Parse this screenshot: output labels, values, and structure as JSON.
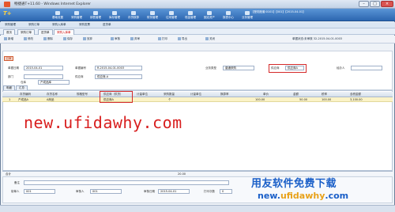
{
  "window": {
    "title": "畅捷通T+11.60 - Windows Internet Explorer"
  },
  "menubar": {
    "logo": "T+",
    "items": [
      "基础设置",
      "采购管理",
      "销售管理",
      "库存管理",
      "存货核算",
      "财务管理",
      "往来管理",
      "现金管理",
      "固定资产",
      "报表中心",
      "业务管理",
      "生产管理",
      "系统管理"
    ],
    "userinfo": "【登陆账套:0101】【001】【2015-04-01】"
  },
  "nav": {
    "tabs": [
      "采购管理",
      "采购订单",
      "采购入库单",
      "采购发票",
      "进货单"
    ],
    "doc_tabs": [
      "首页",
      "采购订单",
      "进货单",
      "采购入库单"
    ]
  },
  "toolbar": {
    "items": [
      "新增",
      "修改",
      "删除",
      "保存",
      "放弃",
      "审核",
      "弃审",
      "打印",
      "导出",
      "关闭"
    ],
    "right_label": "单据状态:未审核 32-2015-04-01-0003"
  },
  "form": {
    "badge": "已审",
    "fields": [
      {
        "label": "单据日期",
        "value": "2015-04-01"
      },
      {
        "label": "单据编号",
        "value": "R-2015-04-01-0003"
      },
      {
        "label": "业务类型",
        "value": "普通采购"
      },
      {
        "label": "供应商",
        "value": "供应商-A"
      },
      {
        "label": "部门",
        "value": ""
      },
      {
        "label": "仓库",
        "value": "产成品库"
      },
      {
        "label": "经办人",
        "value": ""
      }
    ],
    "highlight_field": {
      "label": "供应商",
      "value": "供应商A"
    }
  },
  "grid": {
    "tabs": [
      "明细",
      "汇总"
    ],
    "headers": [
      "存货编码",
      "存货名称",
      "规格型号",
      "供应商（供货）",
      "计量单位",
      "采购数量",
      "计量单位",
      "换算率",
      "单价",
      "金额",
      "税率",
      "含税金额"
    ],
    "rows": [
      [
        "1",
        "产成品A",
        "A商品",
        "",
        "供应商A",
        "",
        "100.00",
        "个",
        "",
        "50.00",
        "100.00",
        "3,100.00"
      ]
    ],
    "sum_label": "合计",
    "sum_value": "20.00"
  },
  "watermark": "new.ufidawhy.com",
  "footer": {
    "fields": [
      {
        "label": "备注",
        "value": ""
      },
      {
        "label": "制单人",
        "value": "001"
      },
      {
        "label": "审核人",
        "value": "001"
      },
      {
        "label": "审核日期",
        "value": "2015-04-01"
      },
      {
        "label": "打印次数",
        "value": "0"
      }
    ],
    "brand": "用友软件免费下载",
    "brand_url_a": "new.",
    "brand_url_b": "ufidawhy",
    "brand_url_c": ".com"
  }
}
